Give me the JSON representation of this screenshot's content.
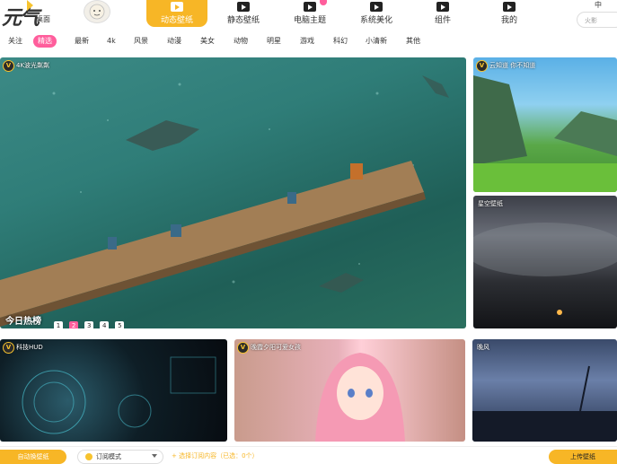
{
  "header": {
    "logo_main": "元气",
    "logo_sub": "桌面",
    "search_placeholder": "火影",
    "window_fragment": "中"
  },
  "nav_tabs": [
    {
      "label": "动态壁纸",
      "icon": "play-video-icon",
      "active": true
    },
    {
      "label": "静态壁纸",
      "icon": "image-icon",
      "active": false
    },
    {
      "label": "电脑主题",
      "icon": "shirt-icon",
      "active": false
    },
    {
      "label": "系统美化",
      "icon": "settings-gear-icon",
      "active": false
    },
    {
      "label": "组件",
      "icon": "widget-icon",
      "active": false
    },
    {
      "label": "我的",
      "icon": "user-icon",
      "active": false
    }
  ],
  "categories": [
    {
      "label": "关注",
      "active": false
    },
    {
      "label": "精选",
      "active": true
    },
    {
      "label": "最新",
      "active": false
    },
    {
      "label": "4k",
      "active": false
    },
    {
      "label": "风景",
      "active": false
    },
    {
      "label": "动漫",
      "active": false
    },
    {
      "label": "美女",
      "active": false
    },
    {
      "label": "动物",
      "active": false
    },
    {
      "label": "明星",
      "active": false
    },
    {
      "label": "游戏",
      "active": false
    },
    {
      "label": "科幻",
      "active": false
    },
    {
      "label": "小清新",
      "active": false
    },
    {
      "label": "其他",
      "active": false
    }
  ],
  "featured": {
    "title": "4K波光粼粼",
    "hot_label": "今日热榜",
    "pages": [
      "1",
      "2",
      "3",
      "4",
      "5"
    ],
    "active_page": "2"
  },
  "wallpapers": [
    {
      "title": "云知道 你不知道"
    },
    {
      "title": "星空壁纸"
    },
    {
      "title": "科技HUD"
    },
    {
      "title": "晚霞夕阳可爱女孩"
    },
    {
      "title": "晚风"
    }
  ],
  "badge_letter": "V",
  "bottom": {
    "auto_change": "自动换壁纸",
    "subscribe_mode": "订阅模式",
    "pick_content": "+ 选择订阅内容（已选：0个）",
    "upload": "上传壁纸"
  },
  "colors": {
    "accent": "#f7b626",
    "active_pink": "#ff5e9c"
  }
}
